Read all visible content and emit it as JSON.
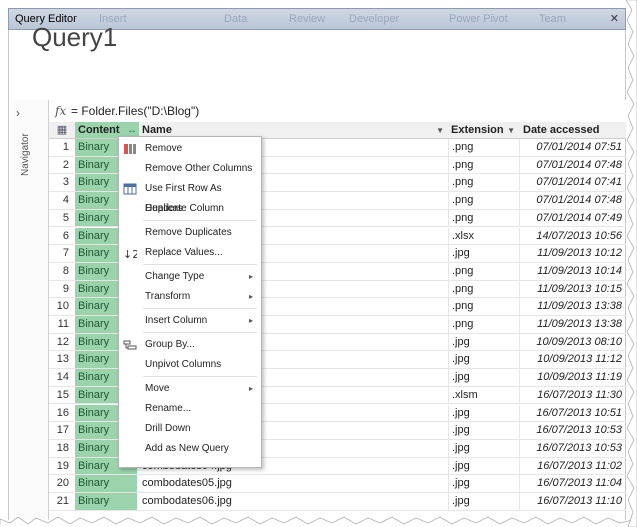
{
  "window": {
    "title": "Query Editor",
    "ghost_tabs": [
      "Insert",
      "Data",
      "Review",
      "Developer",
      "Power Pivot",
      "Team"
    ]
  },
  "query_title": "Query1",
  "navigator": {
    "label": "Navigator",
    "expand_glyph": "›"
  },
  "formula": {
    "fx": "fx",
    "text": "= Folder.Files(\"D:\\Blog\")"
  },
  "columns": {
    "content": "Content",
    "name": "Name",
    "extension": "Extension",
    "date_accessed": "Date accessed"
  },
  "rows": [
    {
      "n": "1",
      "content": "Binary",
      "name": "",
      "ext": ".png",
      "date": "07/01/2014 07:51"
    },
    {
      "n": "2",
      "content": "Binary",
      "name": "",
      "ext": ".png",
      "date": "07/01/2014 07:48"
    },
    {
      "n": "3",
      "content": "Binary",
      "name": "",
      "ext": ".png",
      "date": "07/01/2014 07:41"
    },
    {
      "n": "4",
      "content": "Binary",
      "name": "",
      "ext": ".png",
      "date": "07/01/2014 07:48"
    },
    {
      "n": "5",
      "content": "Binary",
      "name": "",
      "ext": ".png",
      "date": "07/01/2014 07:49"
    },
    {
      "n": "6",
      "content": "Binary",
      "name": "",
      "ext": ".xlsx",
      "date": "14/07/2013 10:56"
    },
    {
      "n": "7",
      "content": "Binary",
      "name": "",
      "ext": ".jpg",
      "date": "11/09/2013 10:12"
    },
    {
      "n": "8",
      "content": "Binary",
      "name": "",
      "ext": ".png",
      "date": "11/09/2013 10:14"
    },
    {
      "n": "9",
      "content": "Binary",
      "name": "",
      "ext": ".png",
      "date": "11/09/2013 10:15"
    },
    {
      "n": "10",
      "content": "Binary",
      "name": "",
      "ext": ".png",
      "date": "11/09/2013 13:38"
    },
    {
      "n": "11",
      "content": "Binary",
      "name": "",
      "ext": ".png",
      "date": "11/09/2013 13:38"
    },
    {
      "n": "12",
      "content": "Binary",
      "name": "",
      "ext": ".jpg",
      "date": "10/09/2013 08:10"
    },
    {
      "n": "13",
      "content": "Binary",
      "name": "",
      "ext": ".jpg",
      "date": "10/09/2013 11:12"
    },
    {
      "n": "14",
      "content": "Binary",
      "name": "",
      "ext": ".jpg",
      "date": "10/09/2013 11:19"
    },
    {
      "n": "15",
      "content": "Binary",
      "name": "",
      "ext": ".xlsm",
      "date": "16/07/2013 11:30"
    },
    {
      "n": "16",
      "content": "Binary",
      "name": "",
      "ext": ".jpg",
      "date": "16/07/2013 10:51"
    },
    {
      "n": "17",
      "content": "Binary",
      "name": "",
      "ext": ".jpg",
      "date": "16/07/2013 10:53"
    },
    {
      "n": "18",
      "content": "Binary",
      "name": "",
      "ext": ".jpg",
      "date": "16/07/2013 10:53"
    },
    {
      "n": "19",
      "content": "Binary",
      "name": "combodates04.jpg",
      "ext": ".jpg",
      "date": "16/07/2013 11:02"
    },
    {
      "n": "20",
      "content": "Binary",
      "name": "combodates05.jpg",
      "ext": ".jpg",
      "date": "16/07/2013 11:04"
    },
    {
      "n": "21",
      "content": "Binary",
      "name": "combodates06.jpg",
      "ext": ".jpg",
      "date": "16/07/2013 11:10"
    }
  ],
  "context_menu": [
    {
      "label": "Remove",
      "icon": "remove-column-icon",
      "submenu": false
    },
    {
      "label": "Remove Other Columns",
      "icon": "",
      "submenu": false
    },
    {
      "label": "Use First Row As Headers",
      "icon": "table-header-icon",
      "submenu": false
    },
    {
      "label": "Duplicate Column",
      "icon": "",
      "submenu": false
    },
    {
      "label": "Remove Duplicates",
      "icon": "",
      "submenu": false
    },
    {
      "label": "Replace Values...",
      "icon": "replace-values-icon",
      "submenu": false
    },
    {
      "label": "Change Type",
      "icon": "",
      "submenu": true
    },
    {
      "label": "Transform",
      "icon": "",
      "submenu": true
    },
    {
      "label": "Insert Column",
      "icon": "",
      "submenu": true
    },
    {
      "label": "Group By...",
      "icon": "group-by-icon",
      "submenu": false
    },
    {
      "label": "Unpivot Columns",
      "icon": "",
      "submenu": false
    },
    {
      "label": "Move",
      "icon": "",
      "submenu": true
    },
    {
      "label": "Rename...",
      "icon": "",
      "submenu": false
    },
    {
      "label": "Drill Down",
      "icon": "",
      "submenu": false
    },
    {
      "label": "Add as New Query",
      "icon": "",
      "submenu": false
    }
  ],
  "colors": {
    "content_column": "#9ad3ac",
    "titlebar": "#c4cfdd"
  }
}
